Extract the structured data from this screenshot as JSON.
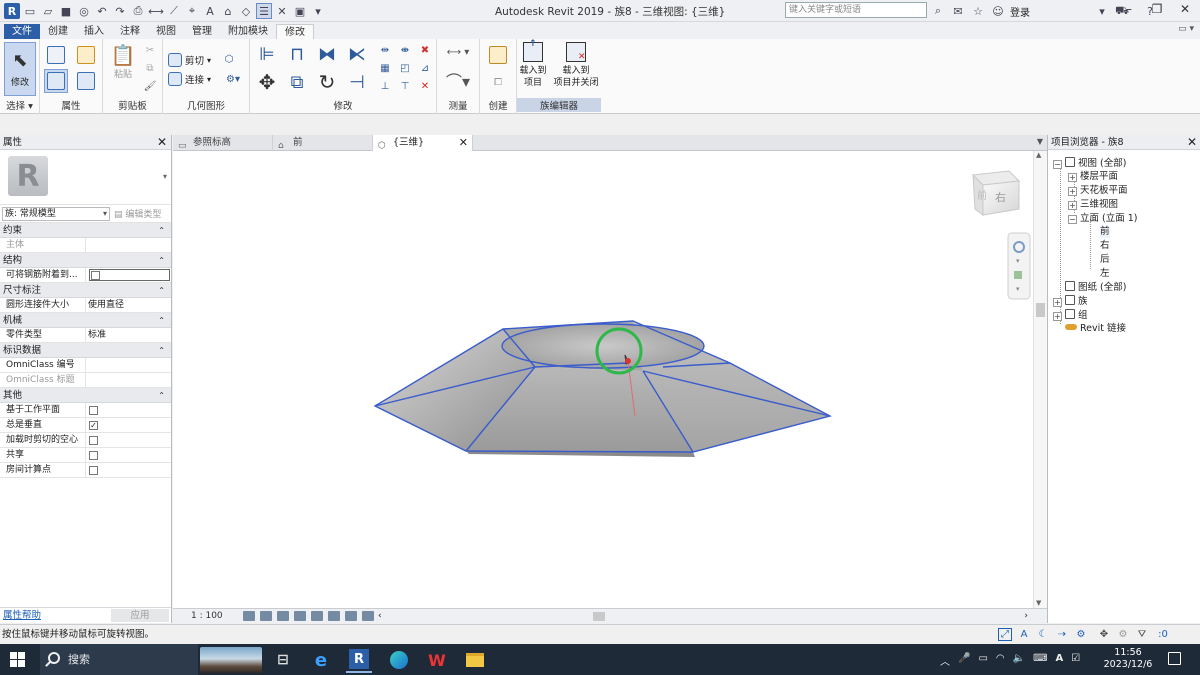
{
  "titlebar": {
    "title": "Autodesk Revit 2019 - 族8 - 三维视图: {三维}",
    "search_placeholder": "键入关键字或短语",
    "login_label": "登录"
  },
  "ribbon_tabs": [
    "文件",
    "创建",
    "插入",
    "注释",
    "视图",
    "管理",
    "附加模块",
    "修改"
  ],
  "ribbon": {
    "modify_label": "修改",
    "paste_label": "粘贴",
    "cut_label": "剪切",
    "join_label": "连接",
    "load_into_project": "载入到\n项目",
    "load_into_project_close": "载入到\n项目并关闭",
    "panels": {
      "select": "选择",
      "properties": "属性",
      "clipboard": "剪贴板",
      "geometry": "几何图形",
      "modify": "修改",
      "measure": "测量",
      "create": "创建",
      "family_editor": "族编辑器"
    }
  },
  "properties": {
    "title": "属性",
    "family_type": "族: 常规模型",
    "edit_type": "编辑类型",
    "groups": [
      {
        "name": "约束",
        "rows": [
          {
            "key": "主体",
            "value": "",
            "grey": true
          }
        ]
      },
      {
        "name": "结构",
        "rows": [
          {
            "key": "可将钢筋附着到...",
            "checkbox": false,
            "big": true
          }
        ]
      },
      {
        "name": "尺寸标注",
        "rows": [
          {
            "key": "圆形连接件大小",
            "value": "使用直径"
          }
        ]
      },
      {
        "name": "机械",
        "rows": [
          {
            "key": "零件类型",
            "value": "标准"
          }
        ]
      },
      {
        "name": "标识数据",
        "rows": [
          {
            "key": "OmniClass 编号",
            "value": ""
          },
          {
            "key": "OmniClass 标题",
            "value": "",
            "grey": true
          }
        ]
      },
      {
        "name": "其他",
        "rows": [
          {
            "key": "基于工作平面",
            "checkbox": false
          },
          {
            "key": "总是垂直",
            "checkbox": true
          },
          {
            "key": "加载时剪切的空心",
            "checkbox": false
          },
          {
            "key": "共享",
            "checkbox": false
          },
          {
            "key": "房间计算点",
            "checkbox": false
          }
        ]
      }
    ],
    "help_link": "属性帮助",
    "apply_label": "应用"
  },
  "view_tabs": [
    {
      "label": "参照标高",
      "active": false
    },
    {
      "label": "前",
      "active": false
    },
    {
      "label": "{三维}",
      "active": true
    }
  ],
  "viewcube_face": "右",
  "view_scale": "1 : 100",
  "project_browser": {
    "title": "项目浏览器 - 族8",
    "nodes": [
      {
        "label": "视图 (全部)",
        "level": 0,
        "expander": "−",
        "icon": true
      },
      {
        "label": "楼层平面",
        "level": 1,
        "expander": "+"
      },
      {
        "label": "天花板平面",
        "level": 1,
        "expander": "+"
      },
      {
        "label": "三维视图",
        "level": 1,
        "expander": "+"
      },
      {
        "label": "立面 (立面 1)",
        "level": 1,
        "expander": "−"
      },
      {
        "label": "前",
        "level": 2,
        "selected": true
      },
      {
        "label": "右",
        "level": 2
      },
      {
        "label": "后",
        "level": 2
      },
      {
        "label": "左",
        "level": 2
      },
      {
        "label": "图纸 (全部)",
        "level": 0,
        "icon": true
      },
      {
        "label": "族",
        "level": 0,
        "expander": "+",
        "icon": true
      },
      {
        "label": "组",
        "level": 0,
        "expander": "+",
        "icon": true
      },
      {
        "label": "Revit 链接",
        "level": 0,
        "link": true
      }
    ]
  },
  "statusbar": {
    "message": "按住鼠标键并移动鼠标可旋转视图。",
    "filter_count": ":0"
  },
  "taskbar": {
    "search_label": "搜索",
    "time": "11:56",
    "date": "2023/12/6",
    "ime": "A"
  },
  "colors": {
    "accent": "#2c5fa8",
    "model_edge": "#3a5ccc",
    "pivot": "#2fb84a"
  }
}
